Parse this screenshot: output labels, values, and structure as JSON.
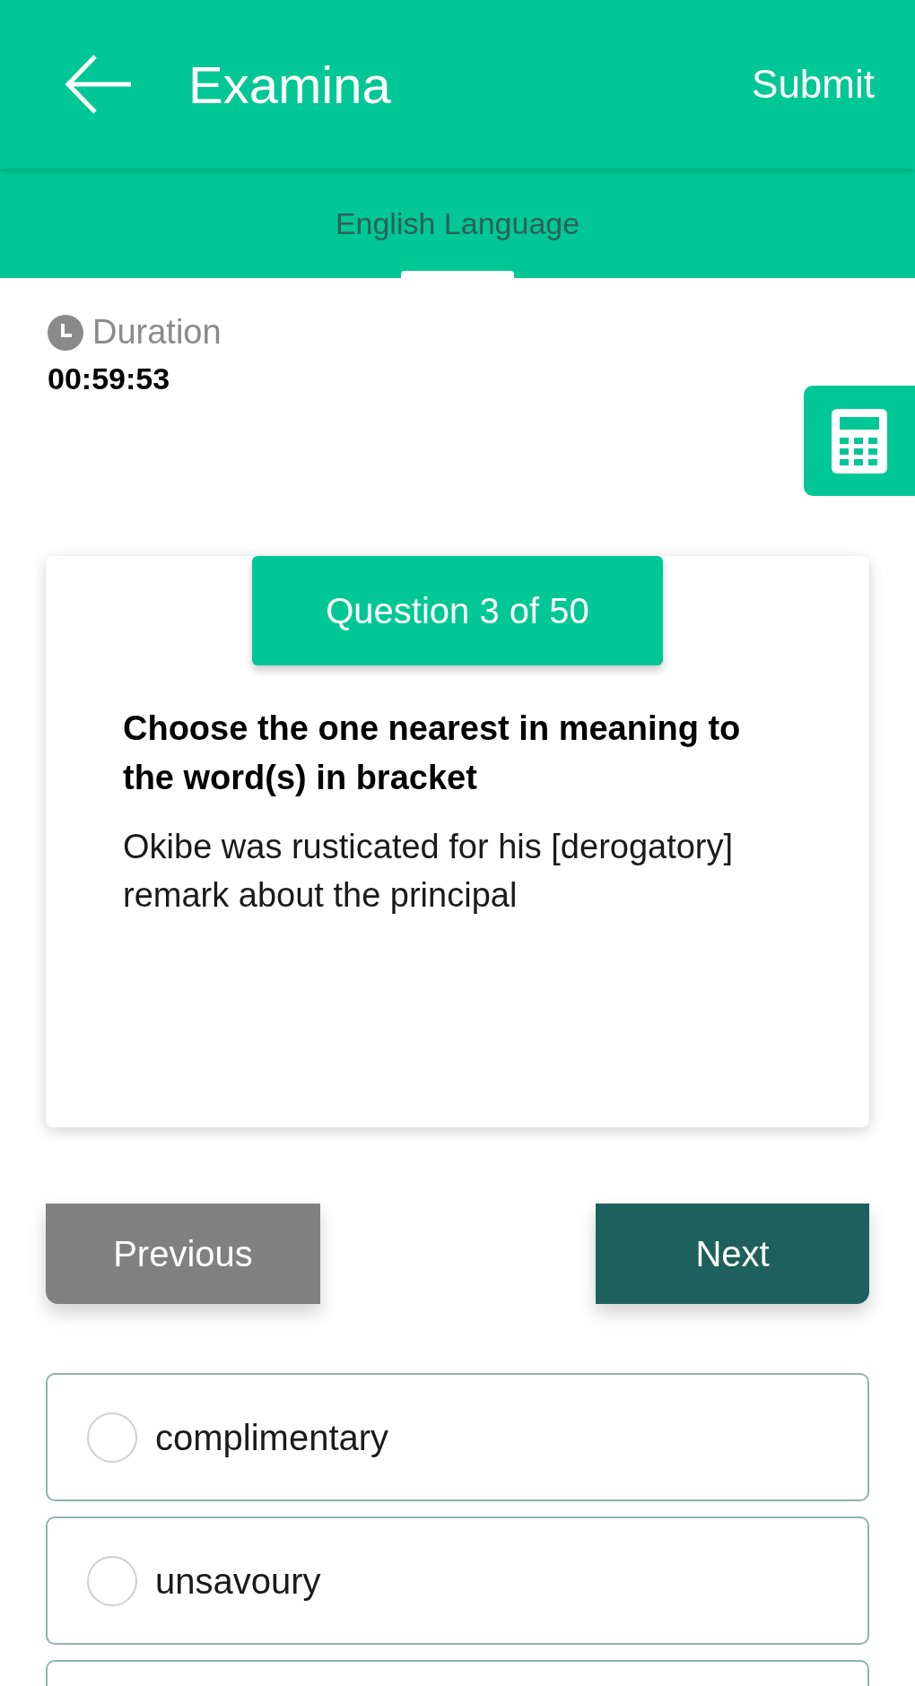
{
  "app_bar": {
    "title": "Examina",
    "action": "Submit"
  },
  "tabs": [
    {
      "label": "English Language",
      "selected": true
    }
  ],
  "timer": {
    "label": "Duration",
    "value": "00:59:53"
  },
  "question": {
    "counter": "Question 3 of 50",
    "instruction": "Choose the one nearest in meaning to the word(s) in bracket",
    "text": "Okibe was rusticated for his [derogatory] remark about the principal"
  },
  "navigation": {
    "previous": "Previous",
    "next": "Next"
  },
  "options": [
    {
      "label": "complimentary",
      "selected": false
    },
    {
      "label": "unsavoury",
      "selected": false
    }
  ]
}
